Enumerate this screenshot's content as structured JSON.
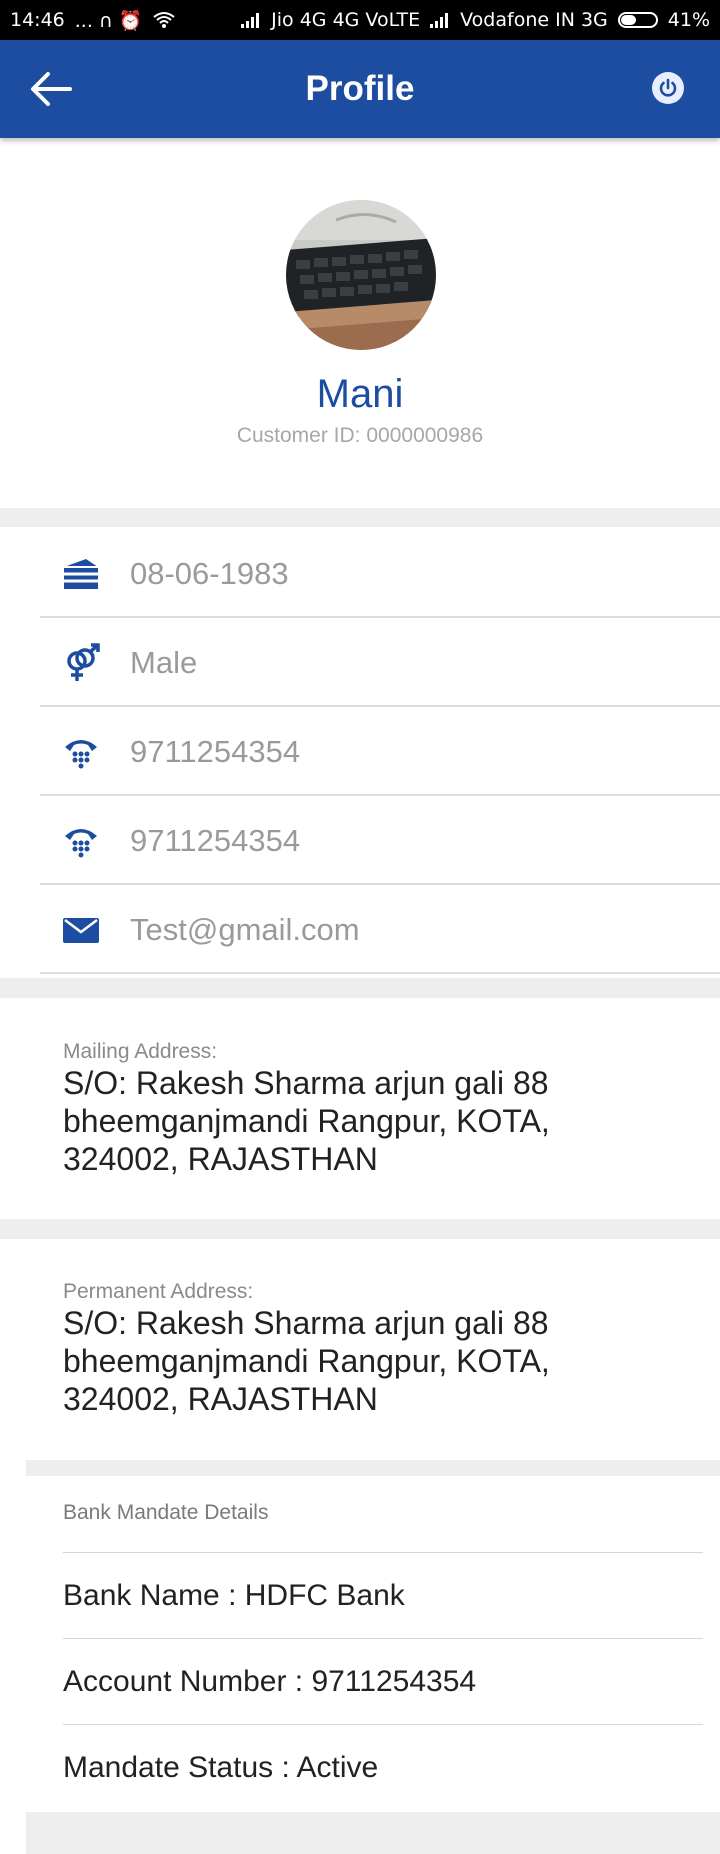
{
  "status_bar": {
    "time": "14:46",
    "left_icons": "... ∩ ⏰",
    "network1": "Jio 4G 4G VoLTE",
    "network2": "Vodafone IN 3G",
    "battery": "41%"
  },
  "app_bar": {
    "title": "Profile"
  },
  "profile": {
    "name": "Mani",
    "customer_id": "Customer ID: 0000000986"
  },
  "fields": {
    "dob": "08-06-1983",
    "gender": "Male",
    "phone1": "9711254354",
    "phone2": "9711254354",
    "email": "Test@gmail.com"
  },
  "mailing_address": {
    "label": "Mailing Address:",
    "line1": "S/O: Rakesh Sharma arjun gali 88",
    "line2": "bheemganjmandi Rangpur, KOTA,",
    "line3": "324002, RAJASTHAN"
  },
  "permanent_address": {
    "label": "Permanent Address:",
    "line1": "S/O: Rakesh Sharma arjun gali 88",
    "line2": "bheemganjmandi Rangpur, KOTA,",
    "line3": "324002, RAJASTHAN"
  },
  "bank": {
    "title": "Bank Mandate Details",
    "bank_name": "Bank Name : HDFC Bank",
    "account_number": "Account Number : 9711254354",
    "mandate_status": "Mandate Status :  Active"
  },
  "colors": {
    "primary": "#1c4da1",
    "background_gap": "#eeeeee"
  },
  "icons": {
    "back": "arrow-left",
    "power": "power",
    "dob": "cake",
    "gender": "gender",
    "phone": "phone",
    "email": "envelope"
  }
}
